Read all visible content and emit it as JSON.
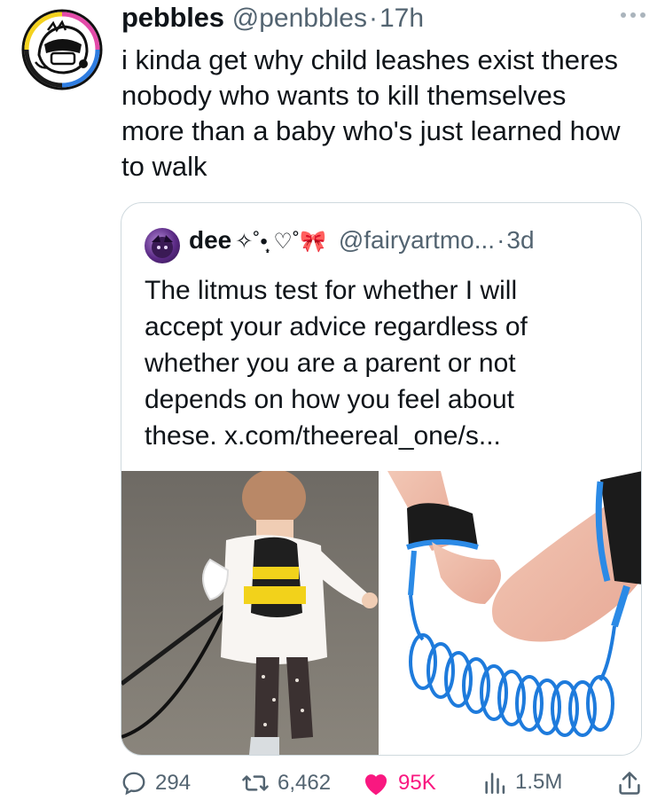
{
  "tweet": {
    "author_name": "pebbles",
    "author_handle": "@penbbles",
    "separator": "·",
    "time": "17h",
    "text": "i kinda get why child leashes exist theres\nnobody who wants to kill themselves\nmore than a baby who's just learned how\nto walk"
  },
  "quote": {
    "author_name": "dee",
    "author_decoration": "✧˚•̩̩͙ ♡˚",
    "author_handle": "@fairyartmo...",
    "separator": "·",
    "time": "3d",
    "text": "The litmus test for whether I will\naccept your advice regardless of\nwhether you are a parent or not\ndepends on how you feel about\nthese. x.com/theereal_one/s..."
  },
  "actions": {
    "replies": "294",
    "retweets": "6,462",
    "likes": "95K",
    "views": "1.5M"
  },
  "colors": {
    "text": "#0f1419",
    "secondary": "#536471",
    "like": "#f91880",
    "border": "#cfd9de"
  },
  "icons": [
    "more-icon",
    "bow-icon",
    "reply-icon",
    "retweet-icon",
    "like-icon",
    "views-icon",
    "share-icon"
  ]
}
